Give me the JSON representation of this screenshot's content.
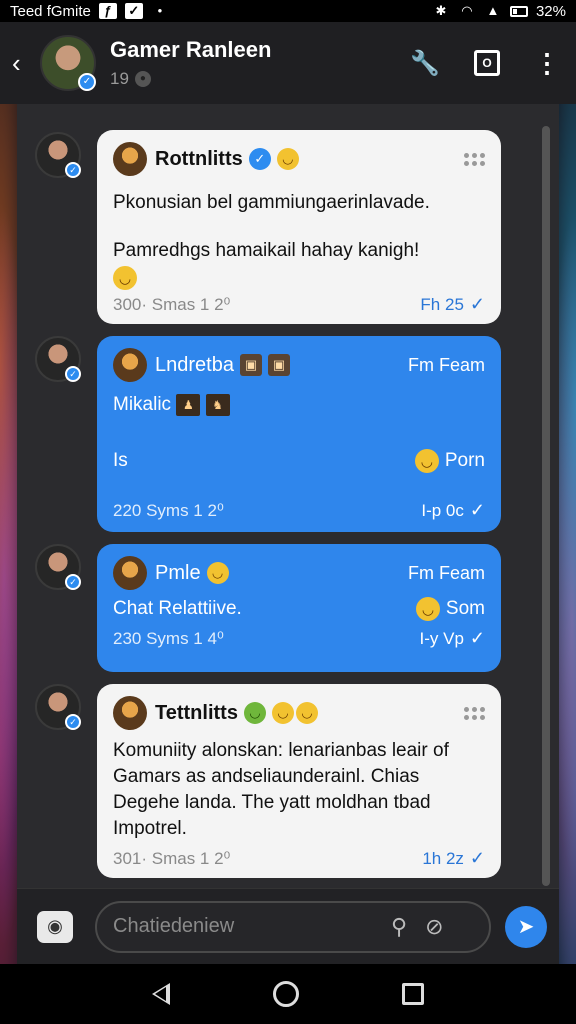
{
  "status_bar": {
    "left_text": "Teed fGmite",
    "right_text": "32%"
  },
  "header": {
    "title": "Gamer Ranleen",
    "subtitle": "19"
  },
  "messages": [
    {
      "style": "white",
      "name": "Rottnlitts",
      "lines": [
        "Pkonusian bel gammiungaerinlavade.",
        "Pamredhgs hamaikail hahay kanigh!"
      ],
      "meta": "300· Smas 1   2⁰",
      "time": "Fh 25"
    },
    {
      "style": "blue",
      "name": "Lndretba",
      "right_label": "Fm Feam",
      "line1": "Mikalic",
      "line2": "Is",
      "line2_right": "Porn",
      "meta": "220 Syms 1   2⁰",
      "time": "I-p 0c"
    },
    {
      "style": "blue",
      "name": "Pmle",
      "right_label": "Fm Feam",
      "line1": "Chat Relattiive.",
      "line1_right": "Som",
      "meta": "230 Syms 1   4⁰",
      "time": "I-y Vp"
    },
    {
      "style": "white",
      "name": "Tettnlitts",
      "text": "Komuniity alonskan: lenarianbas leair of Gamars as andseliaunderainl. Chias Degehe landa. The yatt moldhan tbad Impotrel.",
      "meta": "301· Smas 1   2⁰",
      "time": "1h 2z"
    }
  ],
  "composer": {
    "placeholder": "Chatiedeniew"
  },
  "colors": {
    "accent": "#2f86ec",
    "panel": "#2b2b2e",
    "header": "#1f1f22"
  }
}
